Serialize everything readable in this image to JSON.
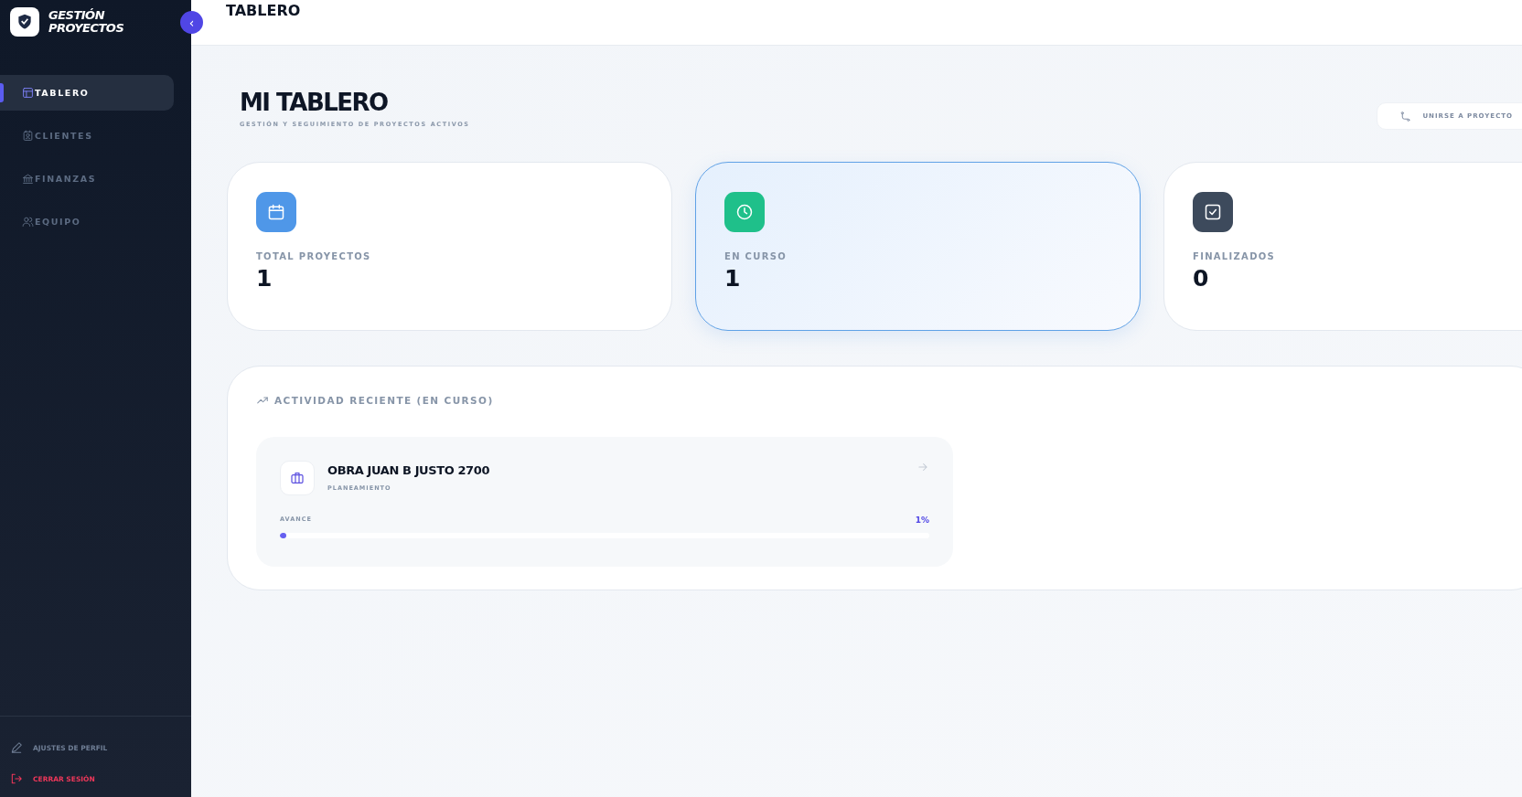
{
  "sidebar": {
    "brand": "GESTIÓN PROYECTOS",
    "collapse_button": "‹",
    "nav": [
      {
        "label": "TABLERO",
        "kind": "board",
        "selected": true
      },
      {
        "label": "CLIENTES",
        "kind": "contact",
        "selected": false
      },
      {
        "label": "FINANZAS",
        "kind": "bank",
        "selected": false
      },
      {
        "label": "EQUIPO",
        "kind": "users",
        "selected": false
      }
    ],
    "footer": [
      {
        "label": "AJUSTES DE PERFIL",
        "kind": "settings"
      },
      {
        "label": "CERRAR SESIÓN",
        "kind": "logout"
      }
    ]
  },
  "header": {
    "title": "TABLERO"
  },
  "page": {
    "title": "MI TABLERO",
    "subtitle": "GESTIÓN Y SEGUIMIENTO DE PROYECTOS ACTIVOS",
    "join_button": "UNIRSE A PROYECTO"
  },
  "stats": [
    {
      "label": "TOTAL PROYECTOS",
      "value": "1",
      "kind": "calendar",
      "color": "#4f97e8",
      "highlighted": false
    },
    {
      "label": "EN CURSO",
      "value": "1",
      "kind": "clock",
      "color": "#1fc08a",
      "highlighted": true
    },
    {
      "label": "FINALIZADOS",
      "value": "0",
      "kind": "check",
      "color": "#3d4a5c",
      "highlighted": false
    }
  ],
  "activity": {
    "title": "ACTIVIDAD RECIENTE (EN CURSO)",
    "projects": [
      {
        "name": "OBRA JUAN B JUSTO 2700",
        "phase": "PLANEAMIENTO",
        "progress_label": "AVANCE",
        "reading": "1%",
        "level": 0.01
      }
    ]
  }
}
